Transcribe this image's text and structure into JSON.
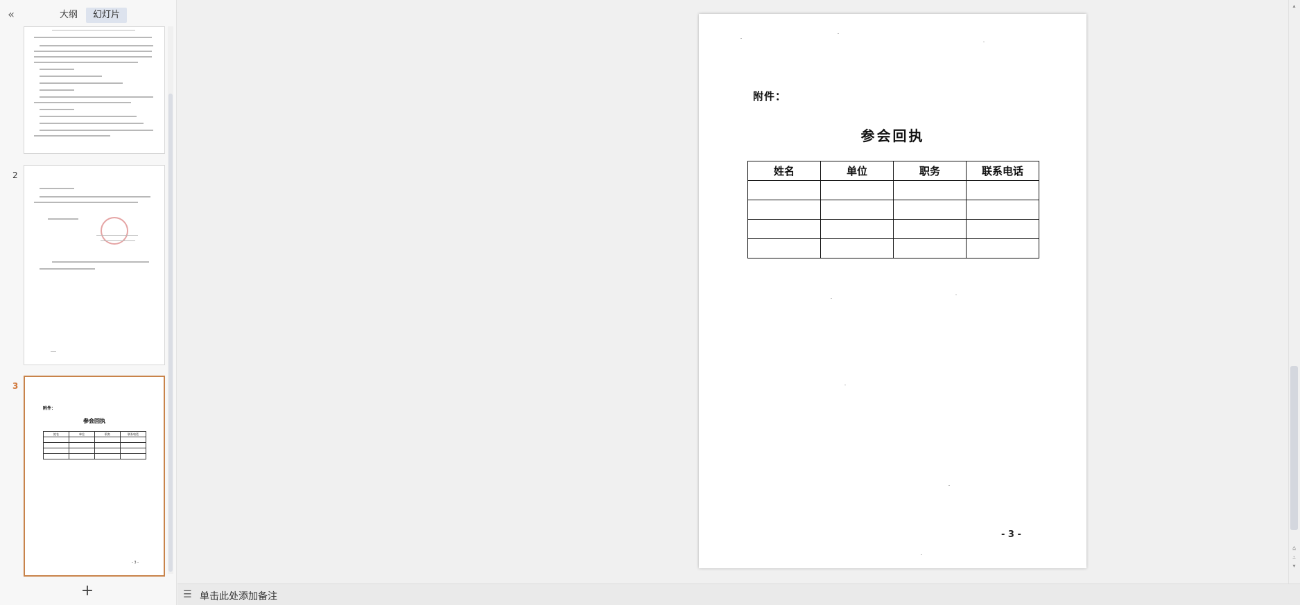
{
  "left_panel": {
    "collapse_icon": "«",
    "tabs": [
      {
        "label": "大纲"
      },
      {
        "label": "幻灯片"
      }
    ],
    "add_icon": "+",
    "thumbnails": [
      {
        "number": ""
      },
      {
        "number": "2"
      },
      {
        "number": "3",
        "label": "附件：",
        "title": "参会回执",
        "headers": [
          "姓名",
          "单位",
          "职务",
          "联系电话"
        ],
        "footer": "- 3 -"
      }
    ]
  },
  "slide": {
    "attachment_label": "附件：",
    "title": "参会回执",
    "table": {
      "headers": [
        "姓名",
        "单位",
        "职务",
        "联系电话"
      ],
      "rows": [
        [
          "",
          "",
          "",
          ""
        ],
        [
          "",
          "",
          "",
          ""
        ],
        [
          "",
          "",
          "",
          ""
        ],
        [
          "",
          "",
          "",
          ""
        ]
      ]
    },
    "page_number": "- 3 -"
  },
  "notes": {
    "icon": "notes-icon",
    "placeholder": "单击此处添加备注"
  },
  "colors": {
    "selected_thumb_border": "#c8834a",
    "active_tab_bg": "#dde3ee"
  }
}
